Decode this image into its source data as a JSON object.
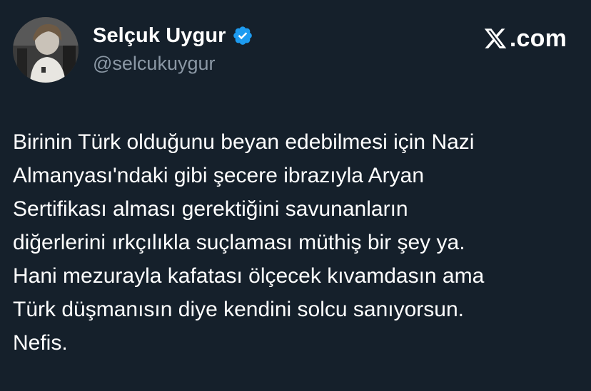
{
  "author": {
    "display_name": "Selçuk Uygur",
    "handle": "@selcukuygur",
    "verified": true
  },
  "brand": {
    "icon": "x-logo-icon",
    "text": ".com"
  },
  "tweet": {
    "lines": [
      "Birinin Türk olduğunu beyan edebilmesi için Nazi",
      "Almanyası'ndaki gibi şecere ibrazıyla Aryan",
      "Sertifikası alması gerektiğini savunanların",
      "diğerlerini ırkçılıkla suçlaması müthiş bir şey ya.",
      "Hani mezurayla kafatası ölçecek kıvamdasın ama",
      "Türk düşmanısın diye kendini solcu sanıyorsun.",
      "Nefis."
    ]
  },
  "colors": {
    "background": "#15202b",
    "text": "#ffffff",
    "secondary_text": "#8b98a5",
    "verified_badge": "#1d9bf0"
  }
}
